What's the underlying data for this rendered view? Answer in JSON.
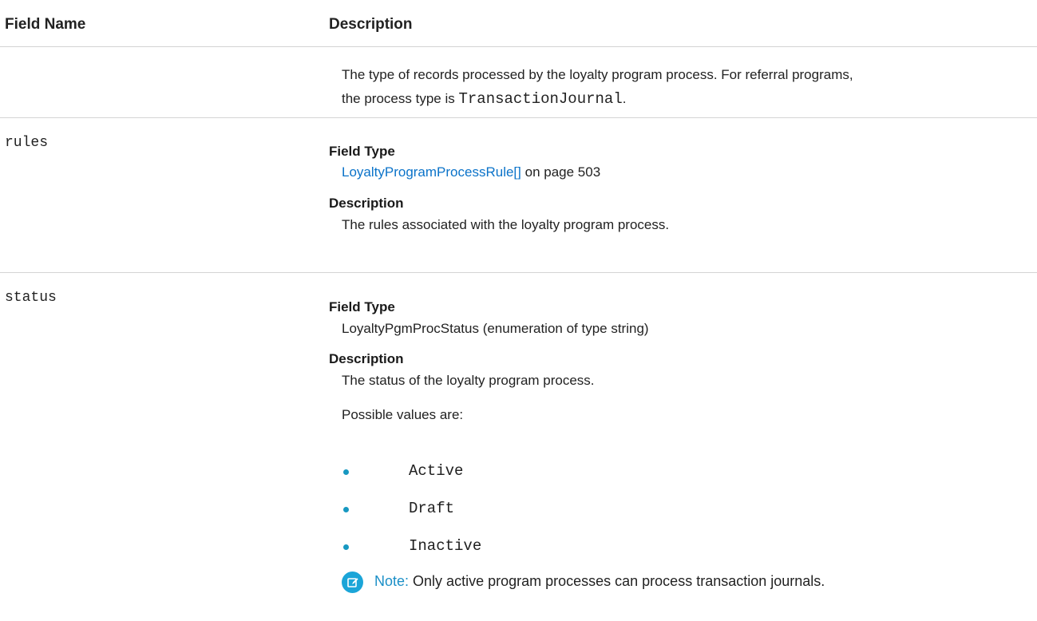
{
  "header": {
    "col_field_name": "Field Name",
    "col_description": "Description"
  },
  "row_processtype": {
    "desc_line1": "The type of records processed by the loyalty program process. For referral programs,",
    "desc_line2_prefix": "the process type is",
    "desc_line2_code": "TransactionJournal",
    "desc_line2_suffix": "."
  },
  "row_rules": {
    "field_name": "rules",
    "field_type_label": "Field Type",
    "field_type_link": "LoyaltyProgramProcessRule[]",
    "field_type_page": "on page 503",
    "description_label": "Description",
    "description": "The rules associated with the loyalty program process."
  },
  "row_status": {
    "field_name": "status",
    "field_type_label": "Field Type",
    "field_type": "LoyaltyPgmProcStatus (enumeration of type string)",
    "description_label": "Description",
    "description": "The status of the loyalty program process.",
    "possible_values_intro": "Possible values are:",
    "values": [
      "Active",
      "Draft",
      "Inactive"
    ],
    "note_label": "Note:",
    "note_text": "Only active program processes can process transaction journals.",
    "note_icon": "edit-note-icon",
    "accent_color": "#1ba5d8"
  }
}
